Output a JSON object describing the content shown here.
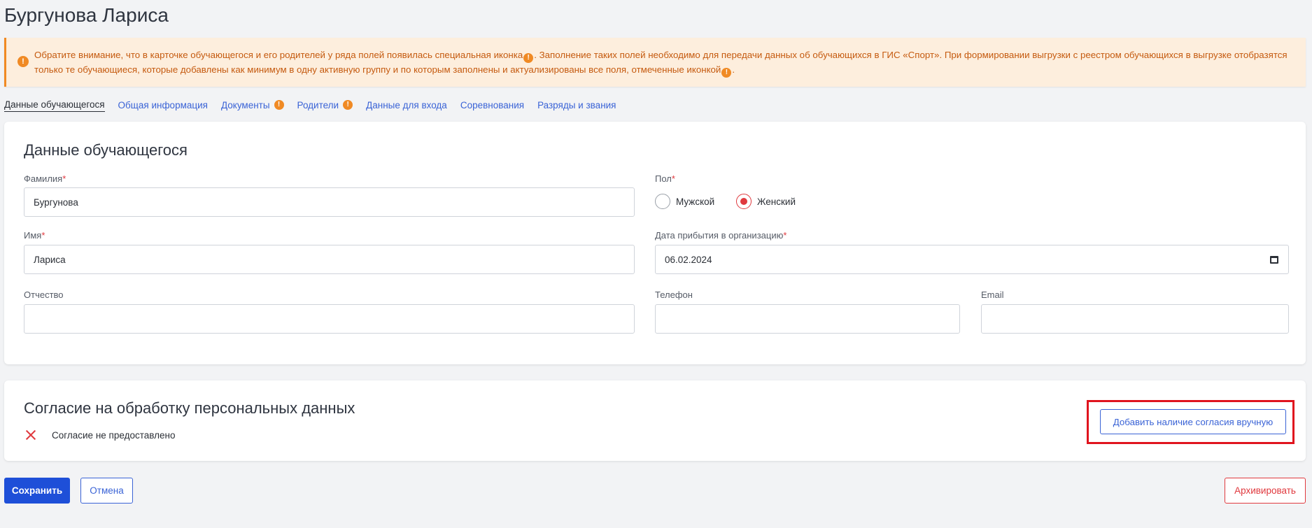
{
  "page": {
    "title": "Бургунова Лариса"
  },
  "notice": {
    "part1": "Обратите внимание, что в карточке обучающегося и его родителей у ряда полей появилась специальная иконка",
    "part2": ". Заполнение таких полей необходимо для передачи данных об обучающихся в ГИС «Спорт». При формировании выгрузки с реестром обучающихся в выгрузке отобразятся только те обучающиеся, которые добавлены как минимум в одну активную группу и по которым заполнены и актуализированы все поля, отмеченные иконкой",
    "part3": ".",
    "icon": "warning-icon",
    "accent_color": "#f08a24"
  },
  "tabs": [
    {
      "label": "Данные обучающегося",
      "active": true
    },
    {
      "label": "Общая информация"
    },
    {
      "label": "Документы",
      "warning": true
    },
    {
      "label": "Родители",
      "warning": true
    },
    {
      "label": "Данные для входа"
    },
    {
      "label": "Соревнования"
    },
    {
      "label": "Разряды и звания"
    }
  ],
  "student_card": {
    "title": "Данные обучающегося",
    "fields": {
      "last_name": {
        "label": "Фамилия",
        "value": "Бургунова"
      },
      "first_name": {
        "label": "Имя",
        "value": "Лариса"
      },
      "patronymic": {
        "label": "Отчество",
        "value": ""
      },
      "gender": {
        "label": "Пол",
        "options": [
          "Мужской",
          "Женский"
        ],
        "selected": "Женский"
      },
      "arrival_date": {
        "label": "Дата прибытия в организацию",
        "value": "06.02.2024"
      },
      "phone": {
        "label": "Телефон",
        "value": ""
      },
      "email": {
        "label": "Email",
        "value": ""
      }
    },
    "required_mark": "*"
  },
  "consent_card": {
    "title": "Согласие на обработку персональных данных",
    "status": "Согласие не предоставлено",
    "add_button": "Добавить наличие согласия вручную"
  },
  "actions": {
    "save": "Сохранить",
    "cancel": "Отмена",
    "archive": "Архивировать"
  },
  "colors": {
    "primary": "#1e4fd8",
    "link": "#3a63d6",
    "danger": "#e0393e",
    "warning": "#f08a24"
  }
}
